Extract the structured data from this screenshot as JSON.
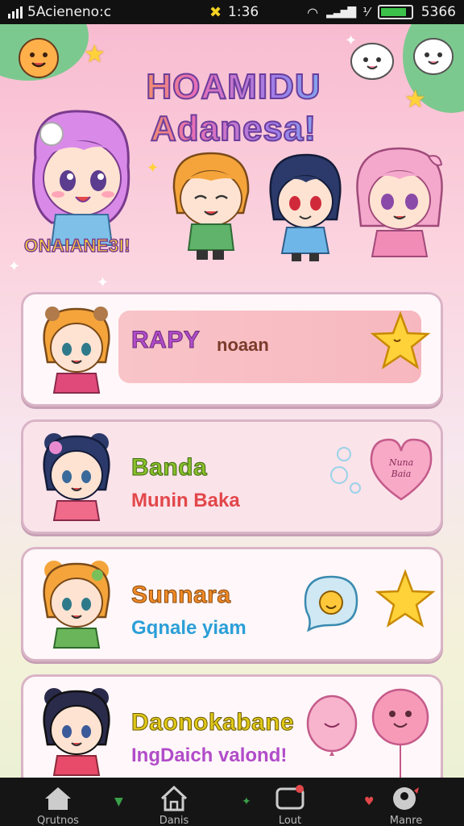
{
  "status_bar": {
    "carrier": "5Acieneno:c",
    "time": "1:36",
    "battery_text": "5366",
    "battery_level": 0.85
  },
  "hero": {
    "title_line1": "HOAMIDU",
    "title_line2": "Adanesa!",
    "badge": "ONAIANE3I!"
  },
  "cards": [
    {
      "title": "RAPY",
      "subtitle": "noaan",
      "title_color": "#b14cc9",
      "subtitle_color": "#7a3b2a",
      "bg": "#f7c0c4",
      "deco": "star-icon"
    },
    {
      "title": "Banda",
      "subtitle": "Munin Baka",
      "title_color": "#8bbf2a",
      "subtitle_color": "#e2474a",
      "bg": "#fbe3ea",
      "deco": "heart-balloon-icon",
      "deco_text": "Nuna\nBaia"
    },
    {
      "title": "Sunnara",
      "subtitle": "Gqnale yiam",
      "title_color": "#f08a26",
      "subtitle_color": "#2b9fd8",
      "bg": "#fff7f9",
      "deco": "speech-bubble-icon"
    },
    {
      "title": "Daonokabane",
      "subtitle": "IngDaich valond!",
      "title_color": "#e0c818",
      "subtitle_color": "#b14cc9",
      "bg": "#fff7f9",
      "deco": "balloon-icon"
    }
  ],
  "nav": [
    {
      "label": "Qrutnos",
      "icon": "home-icon"
    },
    {
      "label": "Danis",
      "icon": "house-icon"
    },
    {
      "label": "Lout",
      "icon": "chat-icon"
    },
    {
      "label": "Manre",
      "icon": "profile-bubble-icon"
    }
  ]
}
